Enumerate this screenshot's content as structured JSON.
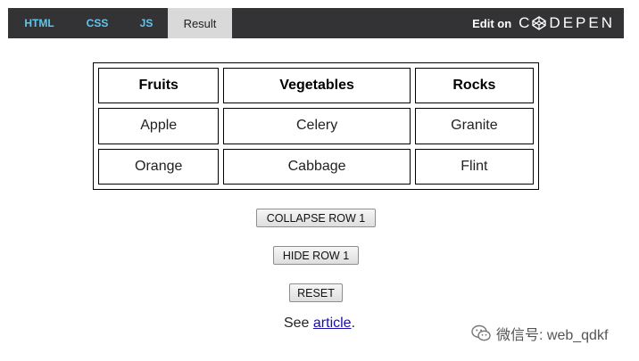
{
  "topbar": {
    "tabs": [
      {
        "label": "HTML"
      },
      {
        "label": "CSS"
      },
      {
        "label": "JS"
      },
      {
        "label": "Result"
      }
    ],
    "edit_on_label": "Edit on",
    "logo_text": "DEPEN",
    "colors": {
      "bar": "#333335",
      "tab_text": "#5fc7ee",
      "active_tab": "#d9d9d9"
    }
  },
  "table": {
    "headers": [
      "Fruits",
      "Vegetables",
      "Rocks"
    ],
    "rows": [
      [
        "Apple",
        "Celery",
        "Granite"
      ],
      [
        "Orange",
        "Cabbage",
        "Flint"
      ]
    ]
  },
  "buttons": {
    "collapse_row": "COLLAPSE ROW 1",
    "hide_row": "HIDE ROW 1",
    "reset": "RESET"
  },
  "footer": {
    "prefix": "See ",
    "link_text": "article",
    "suffix": "."
  },
  "watermark": {
    "icon": "wechat-icon",
    "text": "微信号: web_qdkf"
  }
}
